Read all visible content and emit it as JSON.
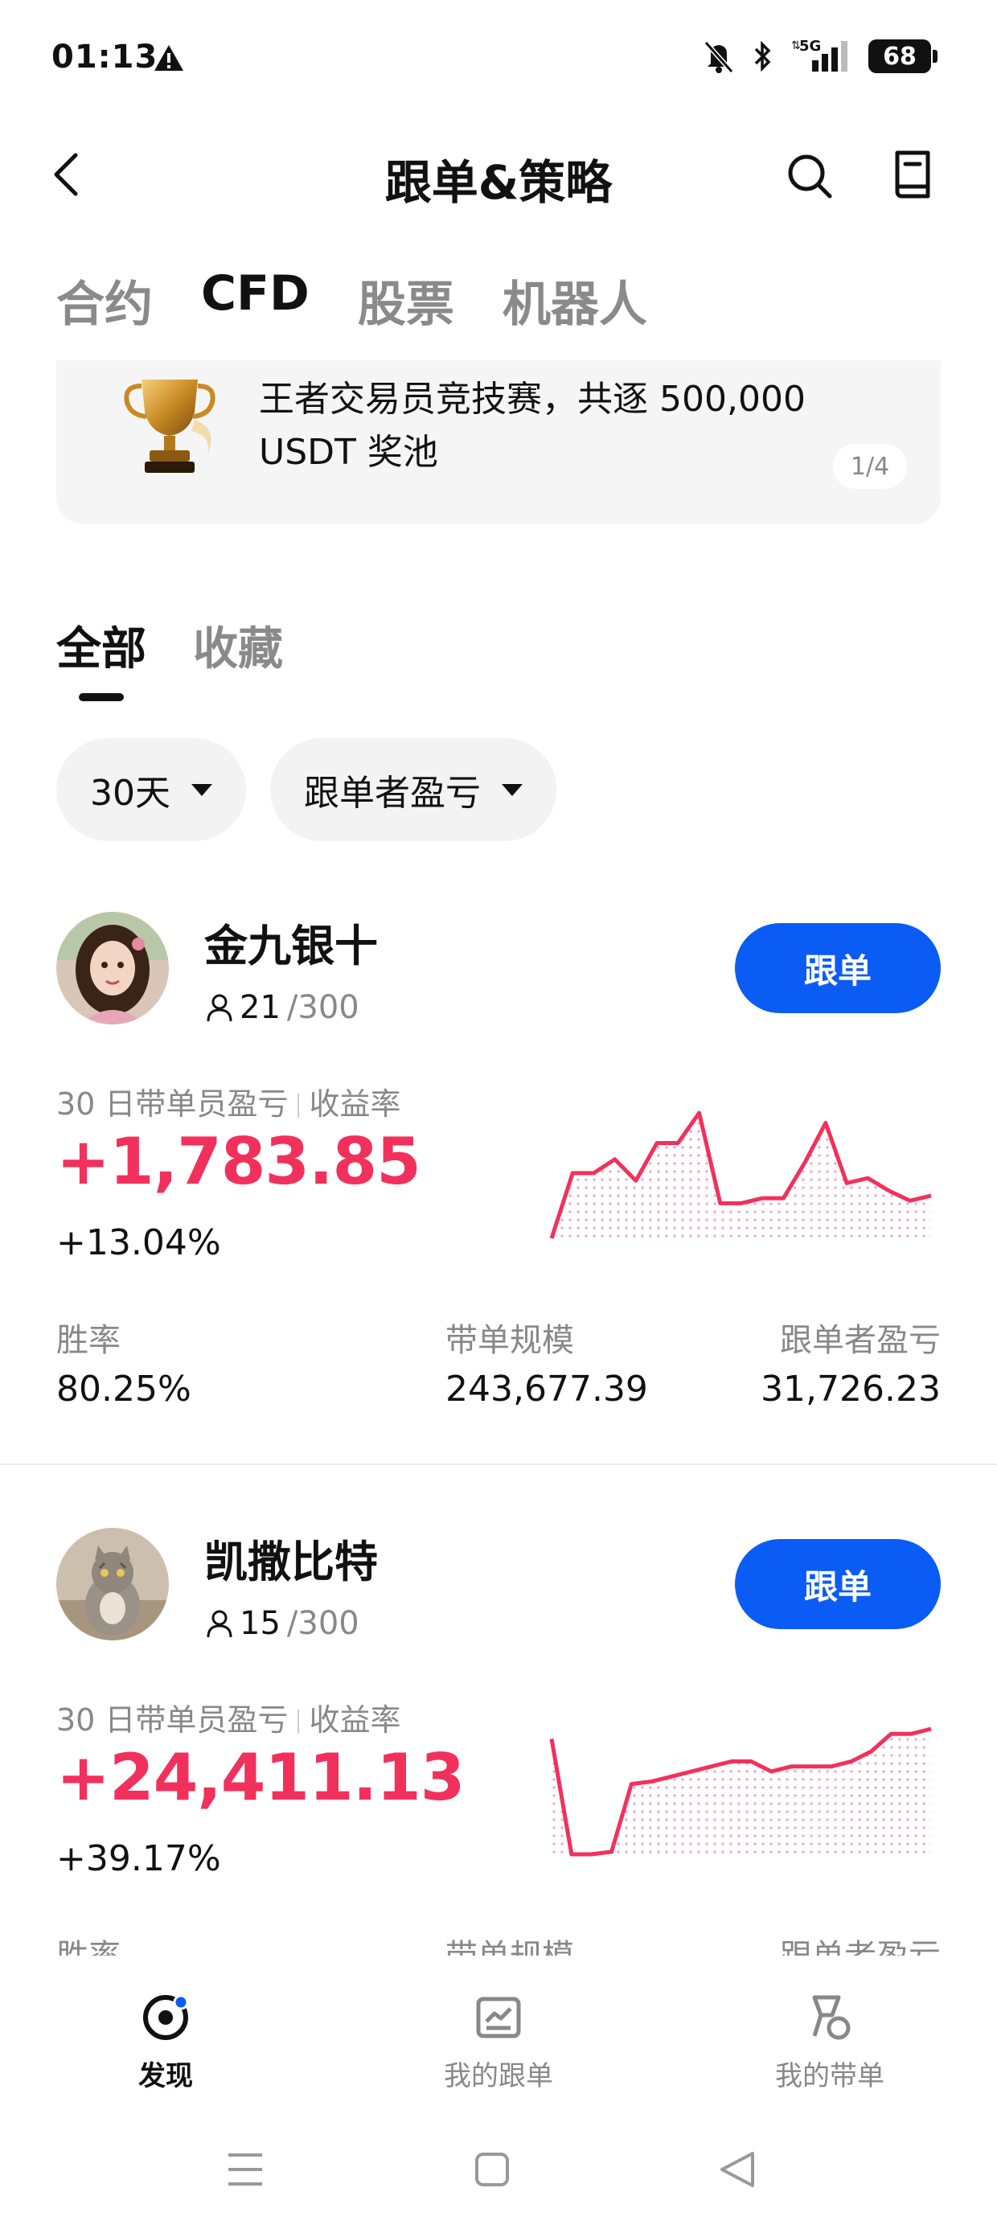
{
  "status_bar": {
    "time": "01:13",
    "network": "5G",
    "battery": "68",
    "icons": [
      "warning-icon",
      "bell-muted-icon",
      "bluetooth-icon",
      "signal-icon",
      "battery-icon"
    ]
  },
  "header": {
    "title": "跟单&策略",
    "icons": [
      "back-icon",
      "search-icon",
      "book-icon"
    ]
  },
  "category_tabs": [
    {
      "label": "合约",
      "active": false
    },
    {
      "label": "CFD",
      "active": true
    },
    {
      "label": "股票",
      "active": false
    },
    {
      "label": "机器人",
      "active": false
    }
  ],
  "banner": {
    "text": "王者交易员竞技赛，共逐 500,000 USDT 奖池",
    "page_indicator": "1/4",
    "icon": "trophy-icon"
  },
  "sub_tabs": [
    {
      "label": "全部",
      "active": true
    },
    {
      "label": "收藏",
      "active": false
    }
  ],
  "filters": [
    {
      "label": "30天"
    },
    {
      "label": "跟单者盈亏"
    }
  ],
  "traders": [
    {
      "name": "金九银十",
      "followers": "21",
      "followers_max": "/300",
      "follow_label": "跟单",
      "metric_label_a": "30 日带单员盈亏",
      "metric_label_b": "收益率",
      "pnl": "+1,783.85",
      "roi": "+13.04%",
      "stats": [
        {
          "label": "胜率",
          "value": "80.25%"
        },
        {
          "label": "带单规模",
          "value": "243,677.39"
        },
        {
          "label": "跟单者盈亏",
          "value": "31,726.23"
        }
      ],
      "sparkline": [
        0.0,
        0.52,
        0.52,
        0.63,
        0.46,
        0.76,
        0.76,
        1.0,
        0.28,
        0.28,
        0.32,
        0.32,
        0.6,
        0.92,
        0.44,
        0.48,
        0.38,
        0.3,
        0.34
      ]
    },
    {
      "name": "凯撒比特",
      "followers": "15",
      "followers_max": "/300",
      "follow_label": "跟单",
      "metric_label_a": "30 日带单员盈亏",
      "metric_label_b": "收益率",
      "pnl": "+24,411.13",
      "roi": "+39.17%",
      "stats": [
        {
          "label": "胜率",
          "value": ""
        },
        {
          "label": "带单规模",
          "value": ""
        },
        {
          "label": "跟单者盈亏",
          "value": ""
        }
      ],
      "sparkline": [
        0.92,
        0.0,
        0.0,
        0.02,
        0.56,
        0.58,
        0.62,
        0.66,
        0.7,
        0.74,
        0.74,
        0.66,
        0.7,
        0.7,
        0.7,
        0.74,
        0.82,
        0.96,
        0.96,
        1.0
      ]
    }
  ],
  "bottom_nav": [
    {
      "label": "发现",
      "icon": "discover-icon",
      "active": true
    },
    {
      "label": "我的跟单",
      "icon": "my-copy-icon",
      "active": false
    },
    {
      "label": "我的带单",
      "icon": "my-lead-icon",
      "active": false
    }
  ],
  "system_nav": [
    "menu-icon",
    "home-icon",
    "back-triangle-icon"
  ]
}
